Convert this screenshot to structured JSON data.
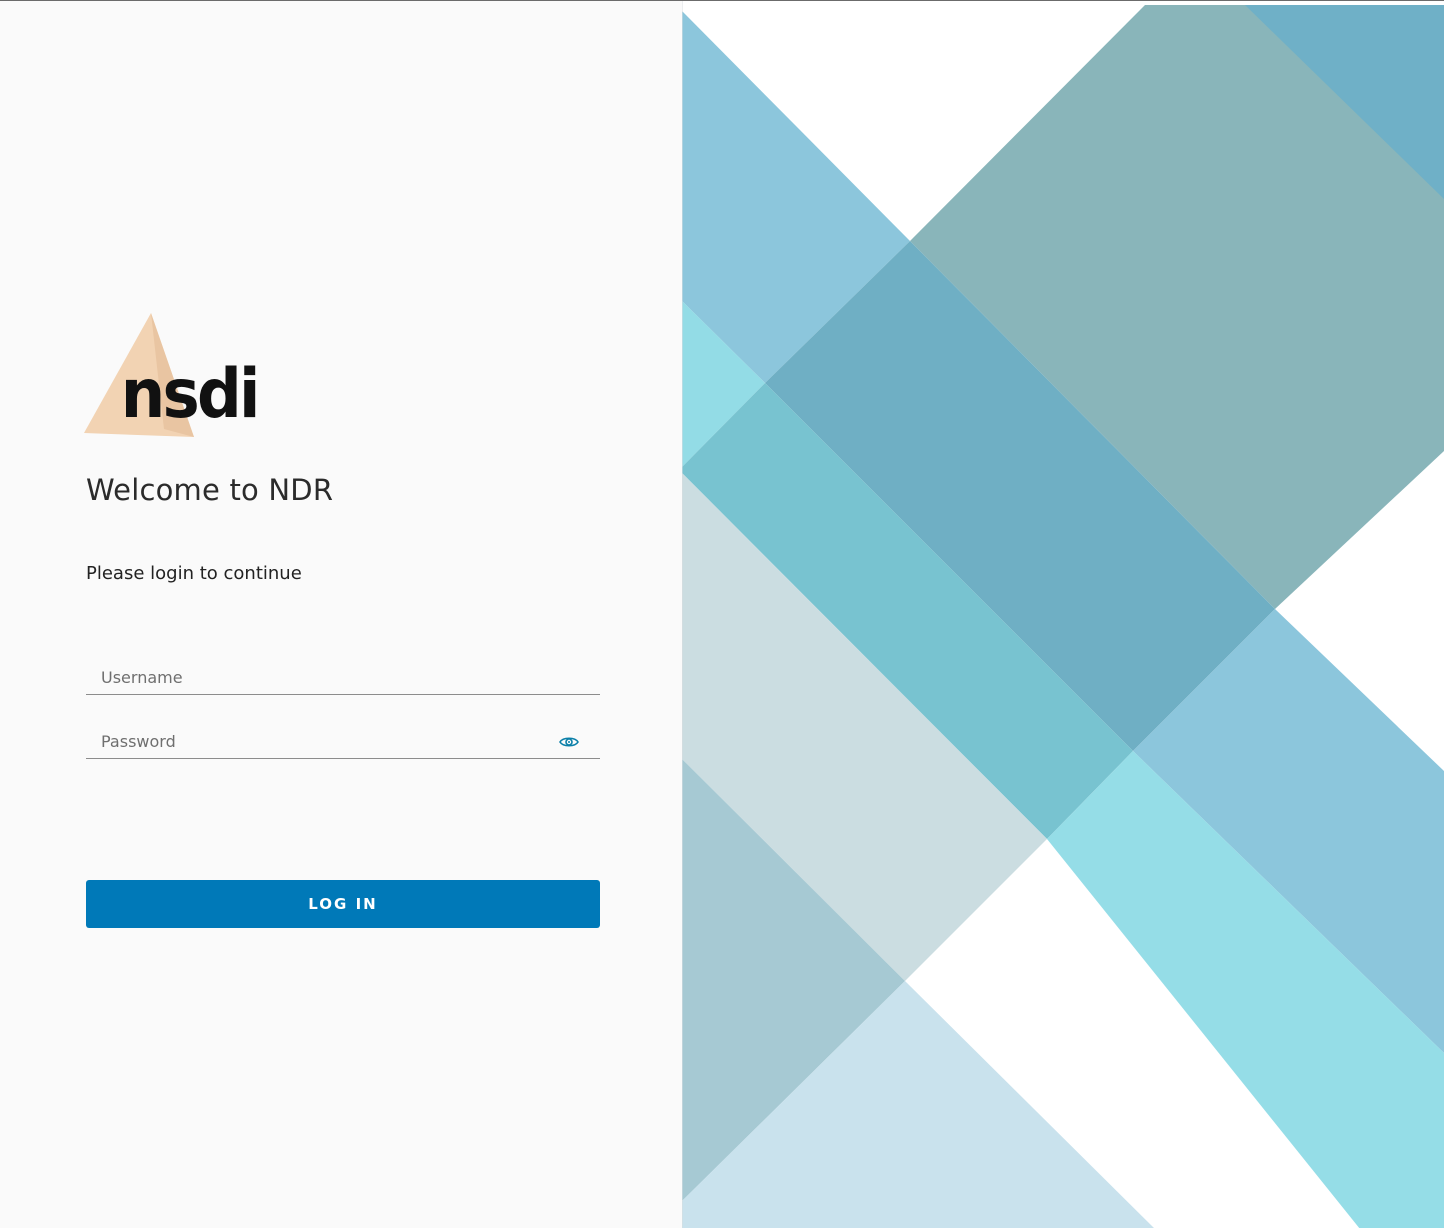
{
  "brand": {
    "logo_text": "nsdi",
    "logo_triangle_color": "#f2d3b3",
    "logo_text_color": "#111111"
  },
  "login": {
    "welcome_title": "Welcome to NDR",
    "subtitle": "Please login to continue",
    "username": {
      "placeholder": "Username",
      "value": ""
    },
    "password": {
      "placeholder": "Password",
      "value": "",
      "reveal_icon": "eye-icon"
    },
    "submit_label": "LOG IN"
  },
  "colors": {
    "primary_button": "#0079b8",
    "reveal_icon": "#0a7fa8",
    "left_background": "#fafafa"
  }
}
